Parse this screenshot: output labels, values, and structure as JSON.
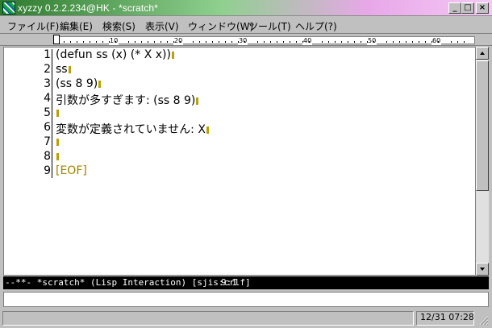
{
  "window": {
    "title": "xyzzy 0.2.2.234@HK - *scratch*",
    "minimize_glyph": "_",
    "maximize_glyph": "□",
    "close_glyph": "×"
  },
  "menu": {
    "items": [
      {
        "label": "ファイル(F)"
      },
      {
        "label": "編集(E)"
      },
      {
        "label": "検索(S)"
      },
      {
        "label": "表示(V)"
      },
      {
        "label": "ウィンドウ(W)"
      },
      {
        "label": "ツール(T)"
      },
      {
        "label": "ヘルプ(?)"
      }
    ]
  },
  "ruler": {
    "labels": [
      "10",
      "20",
      "30",
      "40",
      "50",
      "60"
    ]
  },
  "editor": {
    "line_numbers": [
      "1",
      "2",
      "3",
      "4",
      "5",
      "6",
      "7",
      "8",
      "9"
    ],
    "lines": [
      "(defun ss (x) (* X x))",
      "ss",
      "(ss 8 9)",
      "引数が多すぎます: (ss 8 9)",
      "",
      "変数が定義されていません: X",
      "",
      "",
      "[EOF]"
    ],
    "eol_marker_color": "#b8a000",
    "eof_color": "#a08000"
  },
  "modeline": {
    "text": "--**- *scratch* (Lisp Interaction) [sjis:crlf]",
    "position": "9:1"
  },
  "minibuffer": {
    "value": ""
  },
  "statusbar": {
    "clock": "12/31 07:28"
  },
  "icons": {
    "app": "xyzzy-app-icon",
    "minimize": "minimize-icon",
    "maximize": "maximize-icon",
    "close": "close-icon",
    "scroll_up": "scroll-up-arrow-icon",
    "scroll_down": "scroll-down-arrow-icon"
  }
}
